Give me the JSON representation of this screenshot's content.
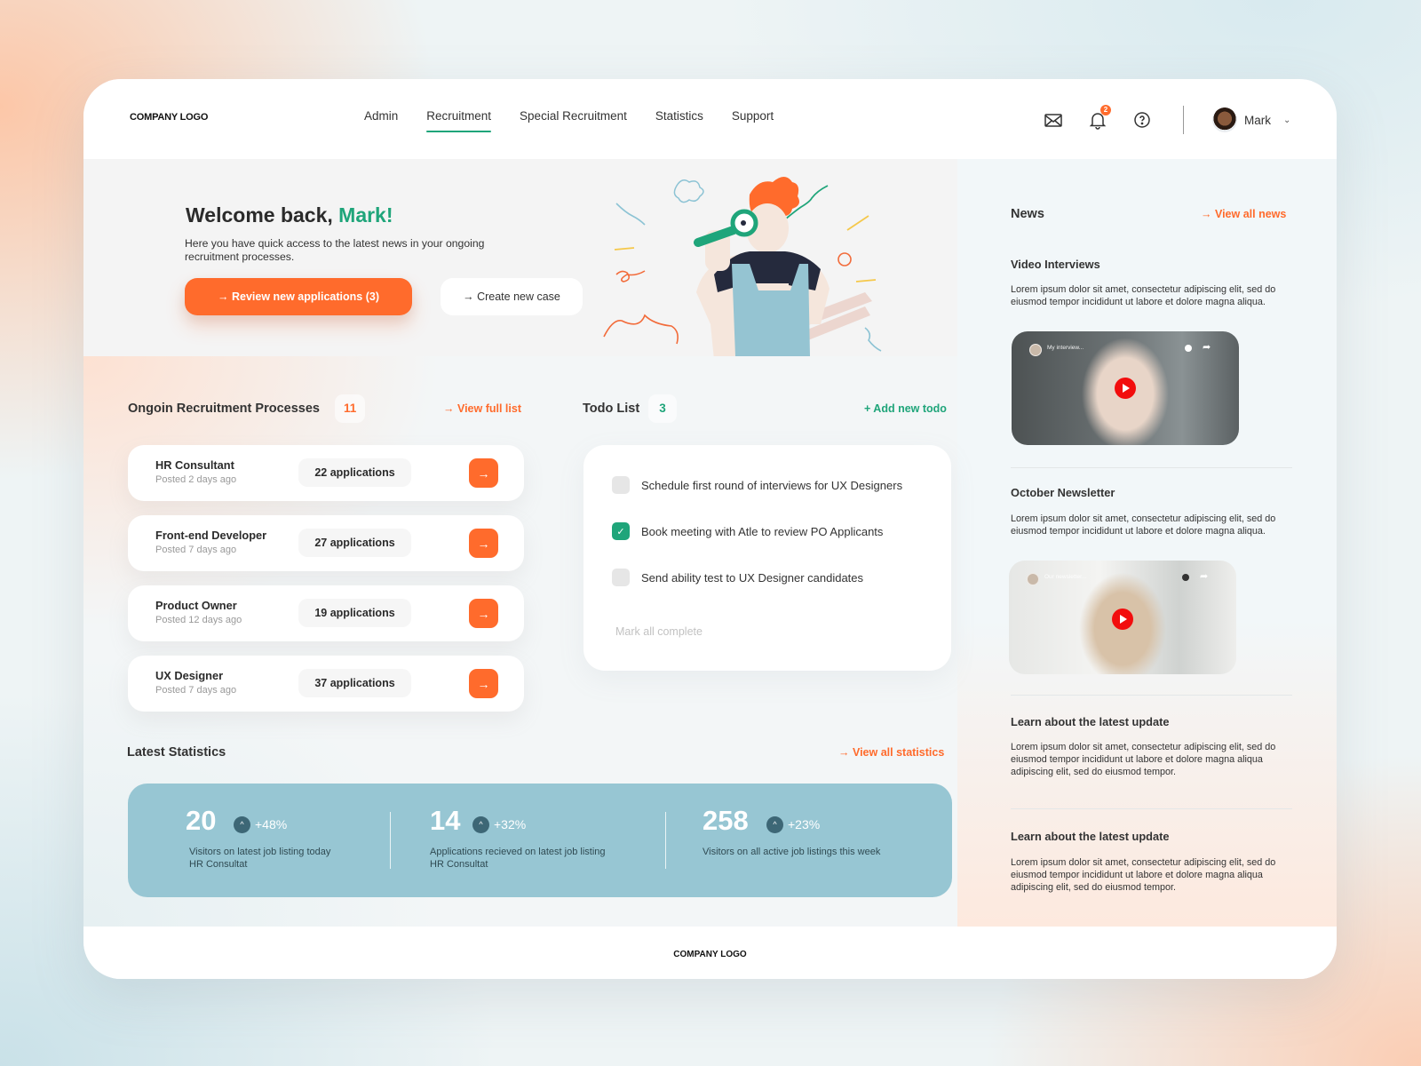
{
  "header": {
    "logo": "COMPANY LOGO",
    "nav": [
      {
        "label": "Admin",
        "active": false
      },
      {
        "label": "Recruitment",
        "active": true
      },
      {
        "label": "Special Recruitment",
        "active": false
      },
      {
        "label": "Statistics",
        "active": false
      },
      {
        "label": "Support",
        "active": false
      }
    ],
    "icons": [
      "mail-icon",
      "bell-icon",
      "help-icon"
    ],
    "notification_count": "2",
    "user_name": "Mark",
    "chevron": "⌄"
  },
  "hero": {
    "greeting": "Welcome back, ",
    "name": "Mark!",
    "subtitle": "Here you have quick access to the latest news in your ongoing recruitment processes.",
    "primary_button": "→ Review new applications (3)",
    "secondary_button": "→ Create new case"
  },
  "processes": {
    "title": "Ongoin Recruitment Processes",
    "count": "11",
    "link": "→ View full list",
    "items": [
      {
        "title": "HR Consultant",
        "posted": "Posted 2 days ago",
        "applications": "22 applications"
      },
      {
        "title": "Front-end Developer",
        "posted": "Posted 7 days ago",
        "applications": "27 applications"
      },
      {
        "title": "Product Owner",
        "posted": "Posted 12 days ago",
        "applications": "19 applications"
      },
      {
        "title": "UX Designer",
        "posted": "Posted 7 days ago",
        "applications": "37 applications"
      }
    ],
    "go_icon": "→"
  },
  "todo": {
    "title": "Todo List",
    "count": "3",
    "add_link": "+ Add new todo",
    "items": [
      {
        "text": "Schedule first round of interviews for UX Designers",
        "checked": false
      },
      {
        "text": "Book meeting with Atle to review PO Applicants",
        "checked": true
      },
      {
        "text": "Send ability test to UX Designer candidates",
        "checked": false
      }
    ],
    "mark_all": "Mark all complete"
  },
  "statistics": {
    "title": "Latest Statistics",
    "link": "→ View all statistics",
    "items": [
      {
        "value": "20",
        "change": "+48%",
        "desc_line1": "Visitors on latest job listing today",
        "desc_line2": "HR Consultat"
      },
      {
        "value": "14",
        "change": "+32%",
        "desc_line1": "Applications recieved on latest job listing",
        "desc_line2": "HR Consultat"
      },
      {
        "value": "258",
        "change": "+23%",
        "desc_line1": "Visitors on all active job listings this week",
        "desc_line2": ""
      }
    ]
  },
  "news": {
    "title": "News",
    "link": "→ View all news",
    "items": [
      {
        "title": "Video Interviews",
        "body": "Lorem ipsum dolor sit amet, consectetur adipiscing elit, sed do eiusmod tempor incididunt ut labore et dolore magna aliqua.",
        "video_title": "My interview..."
      },
      {
        "title": "October Newsletter",
        "body": "Lorem ipsum dolor sit amet, consectetur adipiscing elit, sed do eiusmod tempor incididunt ut labore et dolore magna aliqua.",
        "video_title": "Our newsletter..."
      },
      {
        "title": "Learn about the latest update",
        "body": "Lorem ipsum dolor sit amet, consectetur adipiscing elit, sed do eiusmod tempor incididunt ut labore et dolore magna aliqua adipiscing elit, sed do eiusmod tempor."
      },
      {
        "title": "Learn about the latest update",
        "body": "Lorem ipsum dolor sit amet, consectetur adipiscing elit, sed do eiusmod tempor incididunt ut labore et dolore magna aliqua adipiscing elit, sed do eiusmod tempor."
      }
    ]
  },
  "footer": {
    "logo": "COMPANY LOGO"
  },
  "colors": {
    "accent_orange": "#ff6b2c",
    "accent_green": "#1fa57a",
    "stats_panel": "#97c6d3"
  }
}
